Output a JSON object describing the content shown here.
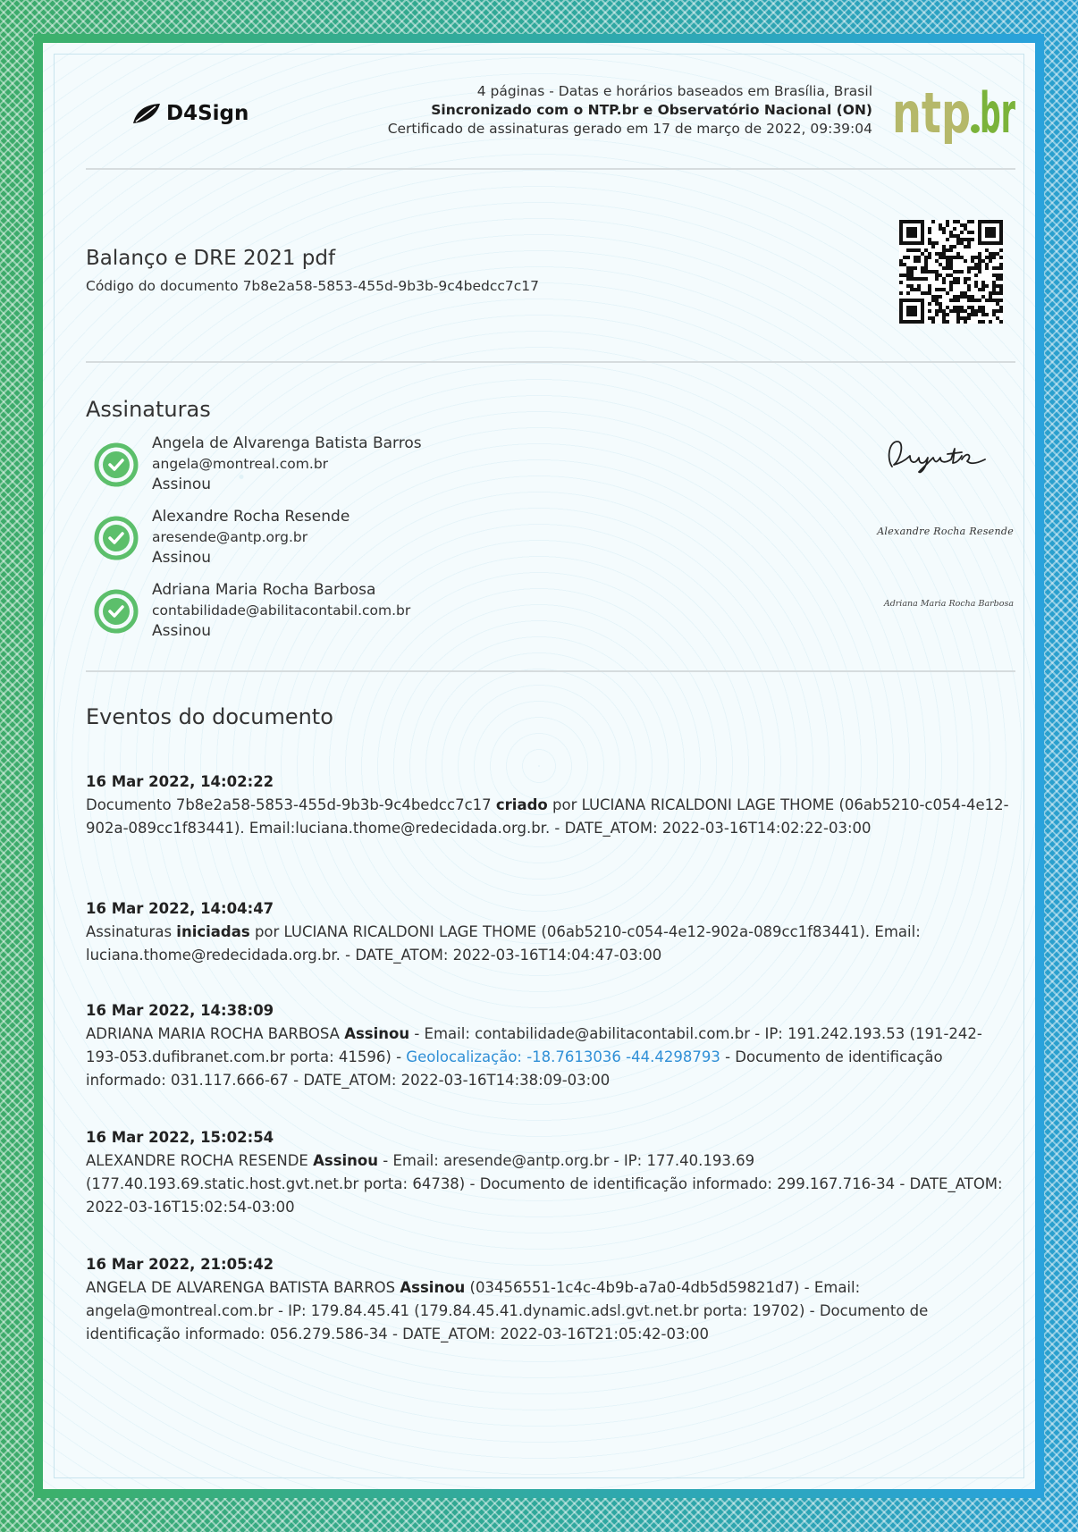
{
  "header": {
    "logo_text": "D4Sign",
    "line1": "4 páginas - Datas e horários baseados em Brasília, Brasil",
    "line2": "Sincronizado com o NTP.br e Observatório Nacional (ON)",
    "line3": "Certificado de assinaturas gerado em 17 de março de 2022, 09:39:04",
    "ntp_logo_text": "ntp.br"
  },
  "document": {
    "title": "Balanço e DRE 2021 pdf",
    "code": "Código do documento 7b8e2a58-5853-455d-9b3b-9c4bedcc7c17"
  },
  "signatures": {
    "title": "Assinaturas",
    "items": [
      {
        "name": "Angela de Alvarenga Batista Barros",
        "email": "angela@montreal.com.br",
        "status": "Assinou"
      },
      {
        "name": "Alexandre Rocha Resende",
        "email": "aresende@antp.org.br",
        "status": "Assinou",
        "signature_text": "Alexandre Rocha Resende"
      },
      {
        "name": "Adriana Maria Rocha Barbosa",
        "email": "contabilidade@abilitacontabil.com.br",
        "status": "Assinou",
        "signature_text": "Adriana Maria Rocha Barbosa"
      }
    ]
  },
  "events": {
    "title": "Eventos do documento",
    "items": [
      {
        "date": "16 Mar 2022, 14:02:22",
        "pre": "Documento 7b8e2a58-5853-455d-9b3b-9c4bedcc7c17 ",
        "action": "criado",
        "post": " por LUCIANA RICALDONI LAGE THOME (06ab5210-c054-4e12-902a-089cc1f83441). Email:luciana.thome@redecidada.org.br. - DATE_ATOM: 2022-03-16T14:02:22-03:00"
      },
      {
        "date": "16 Mar 2022, 14:04:47",
        "pre": "Assinaturas ",
        "action": "iniciadas",
        "post": " por LUCIANA RICALDONI LAGE THOME (06ab5210-c054-4e12-902a-089cc1f83441). Email: luciana.thome@redecidada.org.br. - DATE_ATOM: 2022-03-16T14:04:47-03:00"
      },
      {
        "date": "16 Mar 2022, 14:38:09",
        "pre": "ADRIANA MARIA ROCHA BARBOSA ",
        "action": "Assinou",
        "post": " - Email: contabilidade@abilitacontabil.com.br - IP: 191.242.193.53 (191-242-193-053.dufibranet.com.br porta: 41596) - ",
        "geo": "Geolocalização: -18.7613036 -44.4298793",
        "post2": " - Documento de identificação informado: 031.117.666-67 - DATE_ATOM: 2022-03-16T14:38:09-03:00"
      },
      {
        "date": "16 Mar 2022, 15:02:54",
        "pre": "ALEXANDRE ROCHA RESENDE ",
        "action": "Assinou",
        "post": " - Email: aresende@antp.org.br - IP: 177.40.193.69 (177.40.193.69.static.host.gvt.net.br porta: 64738) - Documento de identificação informado: 299.167.716-34 - DATE_ATOM: 2022-03-16T15:02:54-03:00"
      },
      {
        "date": "16 Mar 2022, 21:05:42",
        "pre": "ANGELA DE ALVARENGA BATISTA BARROS ",
        "action": "Assinou",
        "post": " (03456551-1c4c-4b9b-a7a0-4db5d59821d7) - Email: angela@montreal.com.br - IP: 179.84.45.41 (179.84.45.41.dynamic.adsl.gvt.net.br porta: 19702) - Documento de identificação informado: 056.279.586-34 - DATE_ATOM: 2022-03-16T21:05:42-03:00"
      }
    ]
  },
  "colors": {
    "check_green": "#5cbf6b",
    "link_blue": "#2f8fd6",
    "ntp_green": "#7bb33a",
    "ntp_olive": "#b5b86a"
  }
}
